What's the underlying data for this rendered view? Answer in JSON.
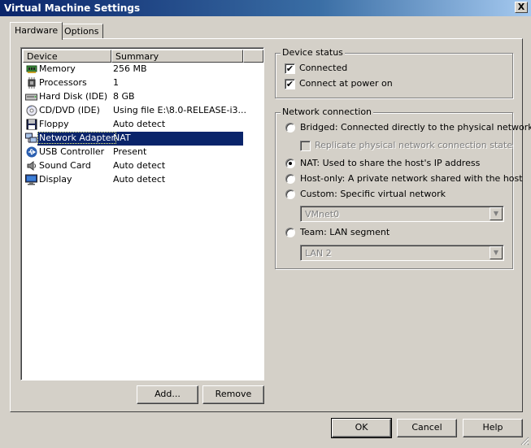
{
  "window": {
    "title": "Virtual Machine Settings",
    "close_glyph": "X"
  },
  "tabs": [
    {
      "label": "Hardware",
      "active": true
    },
    {
      "label": "Options",
      "active": false
    }
  ],
  "device_list": {
    "columns": [
      "Device",
      "Summary"
    ],
    "rows": [
      {
        "device": "Memory",
        "summary": "256 MB",
        "icon": "memory-icon"
      },
      {
        "device": "Processors",
        "summary": "1",
        "icon": "processor-icon"
      },
      {
        "device": "Hard Disk (IDE)",
        "summary": "8 GB",
        "icon": "hard-disk-icon"
      },
      {
        "device": "CD/DVD (IDE)",
        "summary": "Using file E:\\8.0-RELEASE-i3...",
        "icon": "cd-dvd-icon"
      },
      {
        "device": "Floppy",
        "summary": "Auto detect",
        "icon": "floppy-icon"
      },
      {
        "device": "Network Adapter",
        "summary": "NAT",
        "icon": "network-adapter-icon",
        "selected": true
      },
      {
        "device": "USB Controller",
        "summary": "Present",
        "icon": "usb-icon"
      },
      {
        "device": "Sound Card",
        "summary": "Auto detect",
        "icon": "sound-card-icon"
      },
      {
        "device": "Display",
        "summary": "Auto detect",
        "icon": "display-icon"
      }
    ]
  },
  "list_buttons": {
    "add": "Add...",
    "remove": "Remove"
  },
  "device_status": {
    "title": "Device status",
    "connected": {
      "label": "Connected",
      "checked": true
    },
    "connect_at_power_on": {
      "label": "Connect at power on",
      "checked": true
    }
  },
  "network_connection": {
    "title": "Network connection",
    "bridged": {
      "label": "Bridged: Connected directly to the physical network",
      "checked": false
    },
    "replicate": {
      "label": "Replicate physical network connection state",
      "checked": false,
      "enabled": false
    },
    "nat": {
      "label": "NAT: Used to share the host's IP address",
      "checked": true
    },
    "host_only": {
      "label": "Host-only: A private network shared with the host",
      "checked": false
    },
    "custom": {
      "label": "Custom: Specific virtual network",
      "checked": false
    },
    "custom_select": {
      "value": "VMnet0",
      "enabled": false
    },
    "team": {
      "label": "Team: LAN segment",
      "checked": false
    },
    "team_select": {
      "value": "LAN 2",
      "enabled": false
    }
  },
  "footer": {
    "ok": "OK",
    "cancel": "Cancel",
    "help": "Help"
  },
  "colors": {
    "title_bar": "#0a246a",
    "selection": "#0a246a",
    "face": "#d4d0c8"
  }
}
